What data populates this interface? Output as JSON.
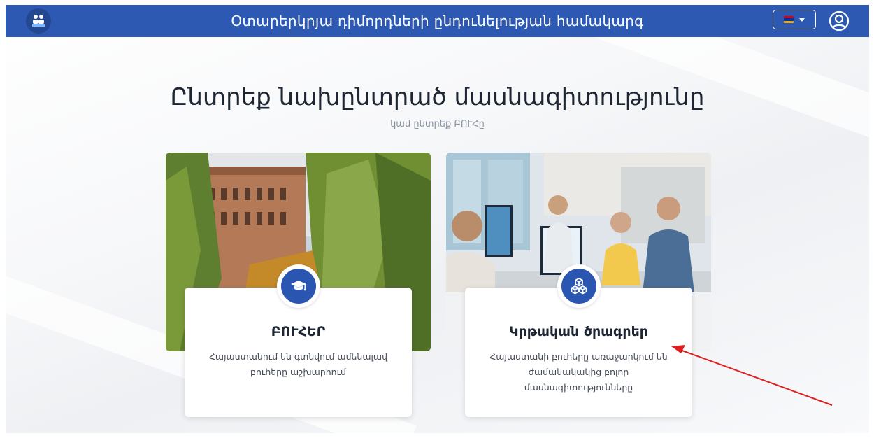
{
  "header": {
    "title": "Օտարերկրյա դիմորդների ընդունելության համակարգ",
    "logo_icon": "users-desk-icon",
    "language_icon": "armenian-flag-icon",
    "language_caret_icon": "caret-down-icon",
    "account_icon": "user-circle-icon"
  },
  "main": {
    "heading": "Ընտրեք նախընտրած մասնագիտությունը",
    "subheading": "կամ ընտրեք ԲՈՒՀը"
  },
  "cards": [
    {
      "title": "ԲՈՒՀԵՐ",
      "description": "Հայաստանում են գտնվում ամենալավ բուհերը աշխարհում",
      "icon": "graduation-cap-icon"
    },
    {
      "title": "Կրթական ծրագրեր",
      "description": "Հայաստանի բուհերը առաջարկում են ժամանակակից բոլոր մասնագիտությունները",
      "icon": "cubes-icon"
    }
  ],
  "colors": {
    "navbar": "#2d59b3",
    "icon_circle": "#2a55b0",
    "annotation_arrow": "#e02020"
  }
}
